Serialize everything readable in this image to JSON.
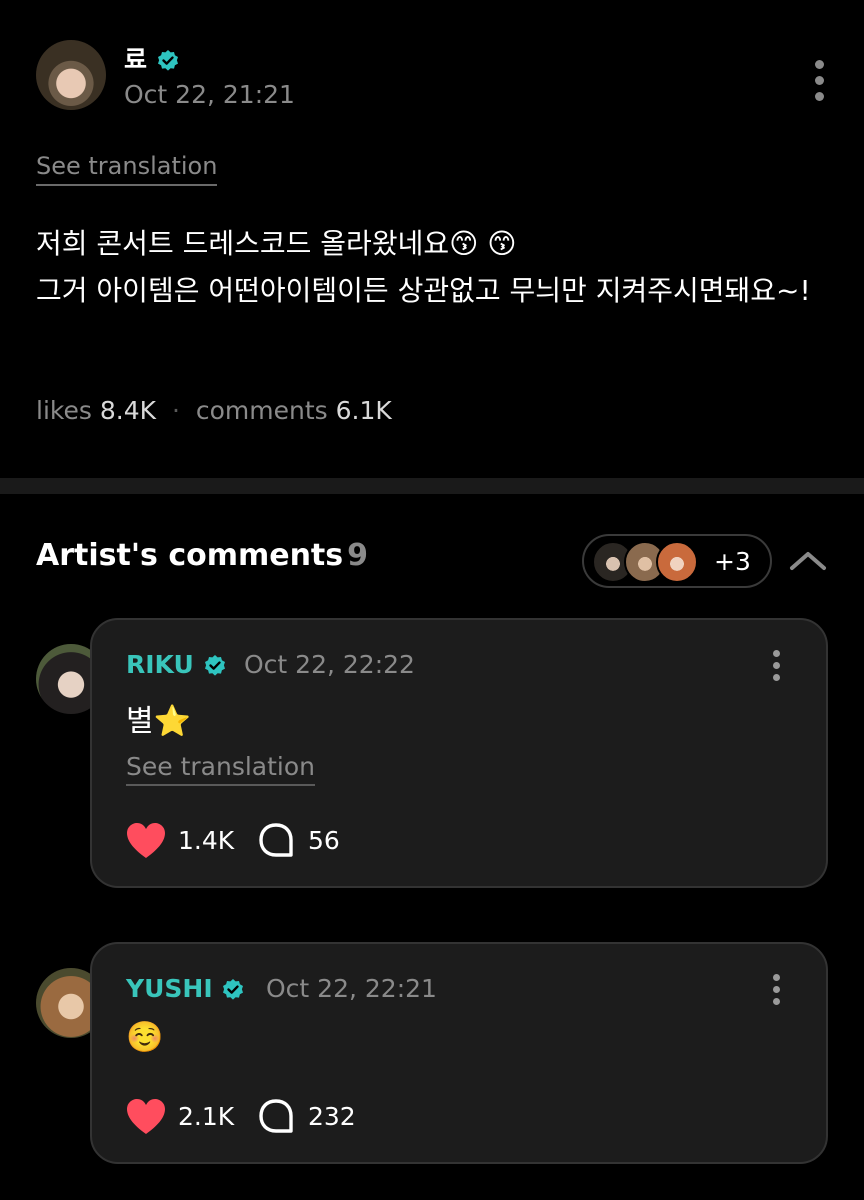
{
  "post": {
    "author": "료",
    "date": "Oct 22, 21:21",
    "see_translation": "See translation",
    "body": "저희 콘서트 드레스코드 올라왔네요😙 😙\n그거 아이템은 어떤아이템이든 상관없고 무늬만 지켜주시면돼요~!",
    "likes_label": "likes",
    "likes_value": "8.4K",
    "separator": "·",
    "comments_label": "comments",
    "comments_value": "6.1K"
  },
  "artist_comments": {
    "title": "Artist's comments",
    "count": "9",
    "more_count": "+3"
  },
  "comments": [
    {
      "name": "RIKU",
      "date": "Oct 22, 22:22",
      "text": "별⭐️",
      "see_translation": "See translation",
      "likes": "1.4K",
      "replies": "56"
    },
    {
      "name": "YUSHI",
      "date": "Oct 22, 22:21",
      "text": "☺️",
      "likes": "2.1K",
      "replies": "232"
    }
  ],
  "colors": {
    "background": "#000000",
    "card": "#1c1c1c",
    "accent_name": "#39c5bb",
    "verified": "#2ec4c0",
    "heart": "#ff4d5e",
    "muted": "#8a8a8a"
  },
  "icons": [
    "verified-badge-icon",
    "more-vertical-icon",
    "chevron-up-icon",
    "heart-icon",
    "comment-bubble-icon"
  ]
}
